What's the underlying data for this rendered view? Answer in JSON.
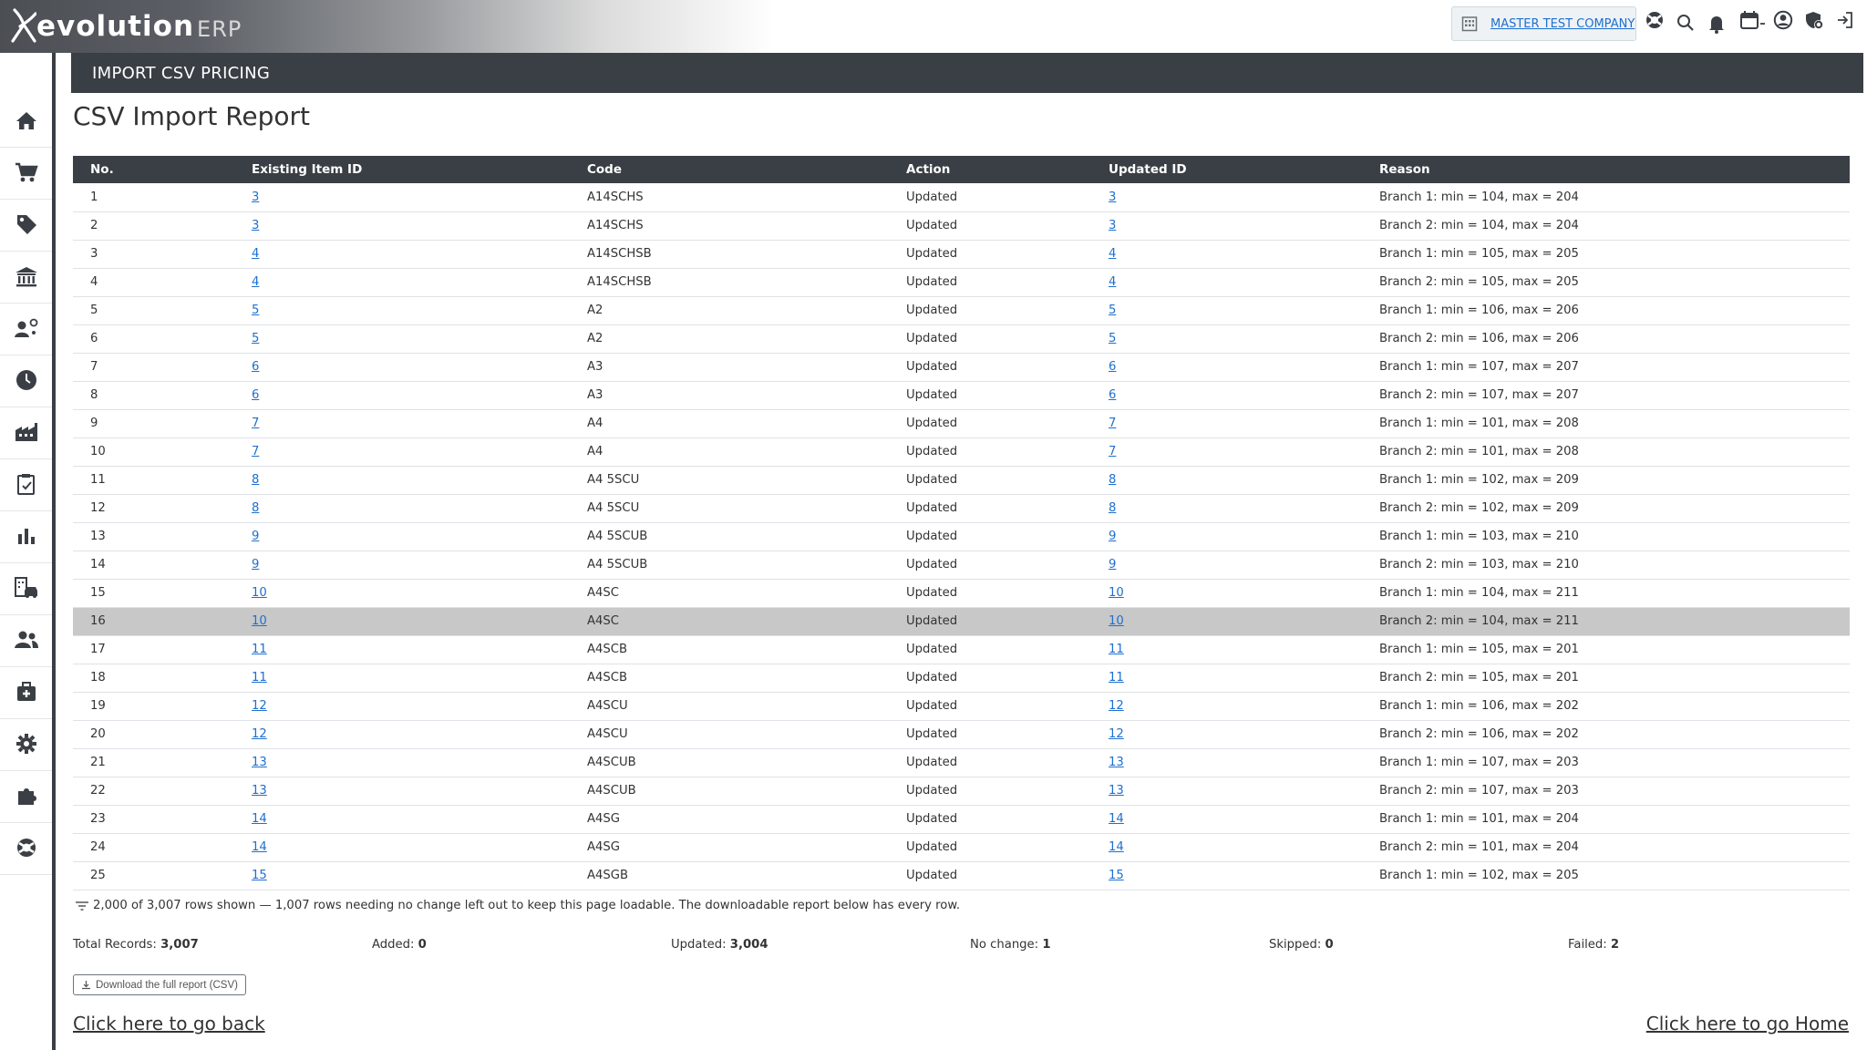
{
  "header": {
    "logo_text": "evolution",
    "logo_suffix": "ERP",
    "company_name": "MASTER TEST COMPANY",
    "icons": [
      "help-icon",
      "search-icon",
      "bell-icon",
      "calendar-icon",
      "user-icon",
      "shield-gear-icon",
      "logout-icon"
    ]
  },
  "sidebar": {
    "items": [
      {
        "name": "home-icon"
      },
      {
        "name": "cart-icon"
      },
      {
        "name": "tag-icon"
      },
      {
        "name": "bank-icon"
      },
      {
        "name": "user-gear-icon"
      },
      {
        "name": "clock-icon"
      },
      {
        "name": "factory-icon"
      },
      {
        "name": "clipboard-check-icon"
      },
      {
        "name": "bar-chart-icon"
      },
      {
        "name": "building-car-icon"
      },
      {
        "name": "users-icon"
      },
      {
        "name": "medical-kit-icon"
      },
      {
        "name": "gear-icon"
      },
      {
        "name": "puzzle-icon"
      },
      {
        "name": "help-icon"
      }
    ]
  },
  "page": {
    "bar_title": "IMPORT CSV PRICING",
    "report_title": "CSV Import Report"
  },
  "table": {
    "columns": [
      "No.",
      "Existing Item ID",
      "Code",
      "Action",
      "Updated ID",
      "Reason"
    ],
    "highlighted_row": 16,
    "rows": [
      {
        "no": "1",
        "existing": "3",
        "code": "A14SCHS",
        "action": "Updated",
        "updated": "3",
        "reason": "Branch 1: min = 104, max = 204"
      },
      {
        "no": "2",
        "existing": "3",
        "code": "A14SCHS",
        "action": "Updated",
        "updated": "3",
        "reason": "Branch 2: min = 104, max = 204"
      },
      {
        "no": "3",
        "existing": "4",
        "code": "A14SCHSB",
        "action": "Updated",
        "updated": "4",
        "reason": "Branch 1: min = 105, max = 205"
      },
      {
        "no": "4",
        "existing": "4",
        "code": "A14SCHSB",
        "action": "Updated",
        "updated": "4",
        "reason": "Branch 2: min = 105, max = 205"
      },
      {
        "no": "5",
        "existing": "5",
        "code": "A2",
        "action": "Updated",
        "updated": "5",
        "reason": "Branch 1: min = 106, max = 206"
      },
      {
        "no": "6",
        "existing": "5",
        "code": "A2",
        "action": "Updated",
        "updated": "5",
        "reason": "Branch 2: min = 106, max = 206"
      },
      {
        "no": "7",
        "existing": "6",
        "code": "A3",
        "action": "Updated",
        "updated": "6",
        "reason": "Branch 1: min = 107, max = 207"
      },
      {
        "no": "8",
        "existing": "6",
        "code": "A3",
        "action": "Updated",
        "updated": "6",
        "reason": "Branch 2: min = 107, max = 207"
      },
      {
        "no": "9",
        "existing": "7",
        "code": "A4",
        "action": "Updated",
        "updated": "7",
        "reason": "Branch 1: min = 101, max = 208"
      },
      {
        "no": "10",
        "existing": "7",
        "code": "A4",
        "action": "Updated",
        "updated": "7",
        "reason": "Branch 2: min = 101, max = 208"
      },
      {
        "no": "11",
        "existing": "8",
        "code": "A4 5SCU",
        "action": "Updated",
        "updated": "8",
        "reason": "Branch 1: min = 102, max = 209"
      },
      {
        "no": "12",
        "existing": "8",
        "code": "A4 5SCU",
        "action": "Updated",
        "updated": "8",
        "reason": "Branch 2: min = 102, max = 209"
      },
      {
        "no": "13",
        "existing": "9",
        "code": "A4 5SCUB",
        "action": "Updated",
        "updated": "9",
        "reason": "Branch 1: min = 103, max = 210"
      },
      {
        "no": "14",
        "existing": "9",
        "code": "A4 5SCUB",
        "action": "Updated",
        "updated": "9",
        "reason": "Branch 2: min = 103, max = 210"
      },
      {
        "no": "15",
        "existing": "10",
        "code": "A4SC",
        "action": "Updated",
        "updated": "10",
        "reason": "Branch 1: min = 104, max = 211"
      },
      {
        "no": "16",
        "existing": "10",
        "code": "A4SC",
        "action": "Updated",
        "updated": "10",
        "reason": "Branch 2: min = 104, max = 211"
      },
      {
        "no": "17",
        "existing": "11",
        "code": "A4SCB",
        "action": "Updated",
        "updated": "11",
        "reason": "Branch 1: min = 105, max = 201"
      },
      {
        "no": "18",
        "existing": "11",
        "code": "A4SCB",
        "action": "Updated",
        "updated": "11",
        "reason": "Branch 2: min = 105, max = 201"
      },
      {
        "no": "19",
        "existing": "12",
        "code": "A4SCU",
        "action": "Updated",
        "updated": "12",
        "reason": "Branch 1: min = 106, max = 202"
      },
      {
        "no": "20",
        "existing": "12",
        "code": "A4SCU",
        "action": "Updated",
        "updated": "12",
        "reason": "Branch 2: min = 106, max = 202"
      },
      {
        "no": "21",
        "existing": "13",
        "code": "A4SCUB",
        "action": "Updated",
        "updated": "13",
        "reason": "Branch 1: min = 107, max = 203"
      },
      {
        "no": "22",
        "existing": "13",
        "code": "A4SCUB",
        "action": "Updated",
        "updated": "13",
        "reason": "Branch 2: min = 107, max = 203"
      },
      {
        "no": "23",
        "existing": "14",
        "code": "A4SG",
        "action": "Updated",
        "updated": "14",
        "reason": "Branch 1: min = 101, max = 204"
      },
      {
        "no": "24",
        "existing": "14",
        "code": "A4SG",
        "action": "Updated",
        "updated": "14",
        "reason": "Branch 2: min = 101, max = 204"
      },
      {
        "no": "25",
        "existing": "15",
        "code": "A4SGB",
        "action": "Updated",
        "updated": "15",
        "reason": "Branch 1: min = 102, max = 205"
      }
    ]
  },
  "note": "2,000 of 3,007 rows shown — 1,007 rows needing no change left out to keep this page loadable. The downloadable report below has every row.",
  "summary": [
    {
      "label": "Total Records:",
      "value": "3,007"
    },
    {
      "label": "Added:",
      "value": "0"
    },
    {
      "label": "Updated:",
      "value": "3,004"
    },
    {
      "label": "No change:",
      "value": "1"
    },
    {
      "label": "Skipped:",
      "value": "0"
    },
    {
      "label": "Failed:",
      "value": "2"
    }
  ],
  "download_label": "Download the full report (CSV)",
  "links": {
    "back": "Click here to go back",
    "home": "Click here to go Home"
  },
  "colors": {
    "header_dark": "#3a3f45",
    "link": "#1e6fd0",
    "highlight_row": "#c8c8c8"
  }
}
